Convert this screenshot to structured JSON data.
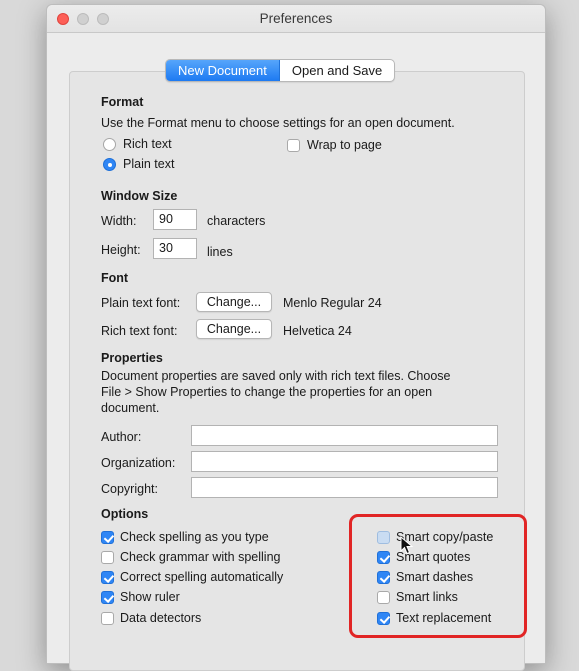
{
  "window": {
    "title": "Preferences"
  },
  "tabs": [
    {
      "label": "New Document",
      "active": true
    },
    {
      "label": "Open and Save",
      "active": false
    }
  ],
  "format": {
    "header": "Format",
    "description": "Use the Format menu to choose settings for an open document.",
    "rich_text_label": "Rich text",
    "plain_text_label": "Plain text",
    "selected": "Plain text",
    "wrap_label": "Wrap to page",
    "wrap_checked": false
  },
  "window_size": {
    "header": "Window Size",
    "width_label": "Width:",
    "width_value": "90",
    "width_unit": "characters",
    "height_label": "Height:",
    "height_value": "30",
    "height_unit": "lines"
  },
  "font": {
    "header": "Font",
    "plain_label": "Plain text font:",
    "plain_button": "Change...",
    "plain_value": "Menlo Regular 24",
    "rich_label": "Rich text font:",
    "rich_button": "Change...",
    "rich_value": "Helvetica 24"
  },
  "properties": {
    "header": "Properties",
    "description_lines": [
      "Document properties are saved only with rich text files. Choose",
      "File > Show Properties to change the properties for an open",
      "document."
    ],
    "author_label": "Author:",
    "author_value": "",
    "organization_label": "Organization:",
    "organization_value": "",
    "copyright_label": "Copyright:",
    "copyright_value": ""
  },
  "options": {
    "header": "Options",
    "left": [
      {
        "label": "Check spelling as you type",
        "checked": true
      },
      {
        "label": "Check grammar with spelling",
        "checked": false
      },
      {
        "label": "Correct spelling automatically",
        "checked": true
      },
      {
        "label": "Show ruler",
        "checked": true
      },
      {
        "label": "Data detectors",
        "checked": false
      }
    ],
    "right": [
      {
        "label": "Smart copy/paste",
        "checked": false,
        "pressed": true
      },
      {
        "label": "Smart quotes",
        "checked": true
      },
      {
        "label": "Smart dashes",
        "checked": true
      },
      {
        "label": "Smart links",
        "checked": false
      },
      {
        "label": "Text replacement",
        "checked": true
      }
    ]
  },
  "colors": {
    "accent": "#2f86f5",
    "annotation": "#e12525"
  }
}
